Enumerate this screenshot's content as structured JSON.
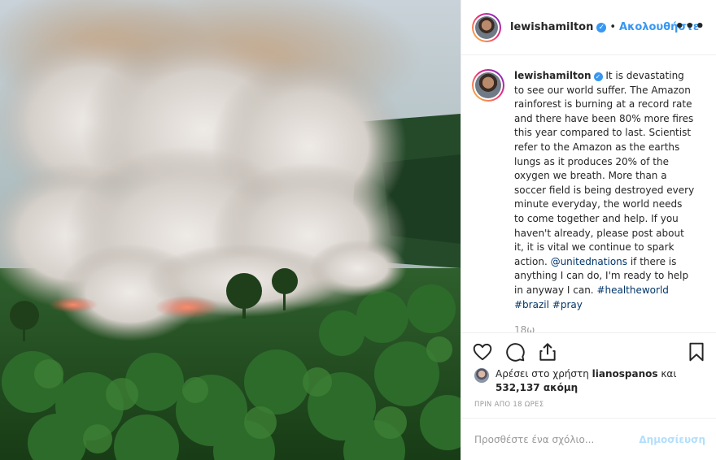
{
  "post": {
    "username": "lewishamilton",
    "follow_label": "Ακολουθήστε",
    "separator": "•",
    "more_label": "•••",
    "verified_mark": "✓"
  },
  "caption": {
    "username": "lewishamilton",
    "text_1": " It is devastating to see our world suffer. The Amazon rainforest is burning at a record rate and there have been 80% more fires this year compared to last. Scientist refer to the Amazon as the earths lungs as it produces 20% of the oxygen we breath. More than a soccer field is being destroyed every minute everyday, the world needs to come together and help. If you haven't already, please post about it, it is vital we continue to spark action. ",
    "mention": "@unitednations",
    "text_2": " if there is anything I can do, I'm ready to help in anyway I can. ",
    "tags": [
      "#healtheworld",
      "#brazil",
      "#pray"
    ],
    "time": "18ω"
  },
  "likes": {
    "prefix": "Αρέσει στο χρήστη ",
    "user": "lianospanos",
    "middle": " και ",
    "count": "532,137 ακόμη"
  },
  "posted_ago": "ΠΡΙΝ ΑΠΟ 18 ΩΡΕΣ",
  "comment": {
    "placeholder": "Προσθέστε ένα σχόλιο...",
    "post_label": "Δημοσίευση"
  },
  "icons": [
    "heart-icon",
    "comment-icon",
    "share-icon",
    "bookmark-icon",
    "more-icon",
    "verified-icon"
  ],
  "colors": {
    "accent": "#3897f0",
    "link": "#003569",
    "muted": "#999999",
    "post_disabled": "#b2dffc"
  }
}
